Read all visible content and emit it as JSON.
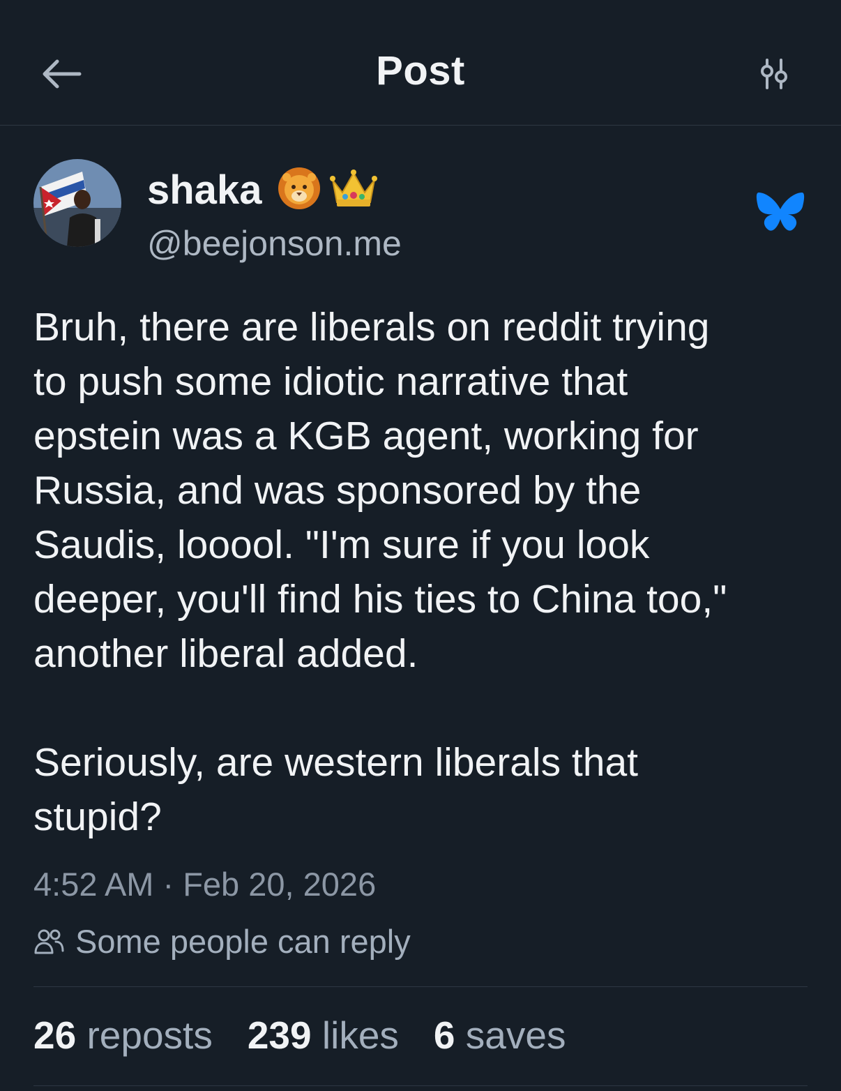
{
  "header": {
    "title": "Post"
  },
  "author": {
    "display_name": "shaka",
    "handle": "@beejonson.me",
    "name_emojis": [
      "lion-face-icon",
      "crown-icon"
    ]
  },
  "post": {
    "text": "Bruh, there are liberals on reddit trying\nto push some idiotic narrative that\nepstein was a KGB agent, working for\nRussia, and was sponsored by the\nSaudis, looool. \"I'm sure if you look\ndeeper, you'll find his ties to China too,\"\nanother liberal added.\n\nSeriously, are western liberals that\nstupid?",
    "timestamp": "4:52 AM · Feb 20, 2026",
    "reply_setting": "Some people can reply"
  },
  "stats": {
    "reposts_count": "26",
    "reposts_label": "reposts",
    "likes_count": "239",
    "likes_label": "likes",
    "saves_count": "6",
    "saves_label": "saves"
  },
  "colors": {
    "background": "#161e27",
    "text_primary": "#f1f3f5",
    "text_secondary": "#a3afbd",
    "bluesky_blue": "#1185fe",
    "divider": "#2e3843"
  }
}
